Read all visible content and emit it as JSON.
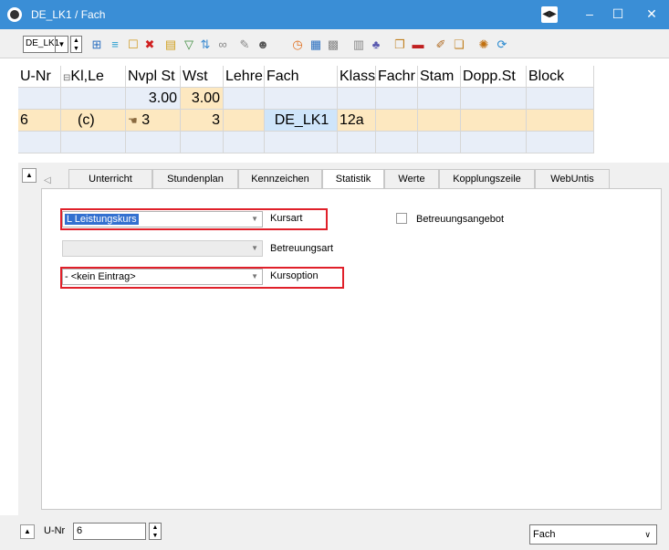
{
  "window": {
    "title": "DE_LK1 / Fach",
    "nav_label": "◀▶",
    "minimize": "–",
    "maximize": "☐",
    "close": "✕"
  },
  "toolbar": {
    "selector_value": "DE_LK1",
    "icons": [
      "new-record-icon",
      "list-icon",
      "edit-icon",
      "delete-icon",
      "filter-list-icon",
      "filter-icon",
      "sort-icon",
      "link-icon",
      "tools-icon",
      "user-icon",
      "clock-icon",
      "calendar-icon",
      "schedule-icon",
      "grid-icon",
      "people-icon",
      "copy-icon",
      "monitor-icon",
      "pencil-icon",
      "page-settings-icon",
      "gear-icon",
      "refresh-icon"
    ]
  },
  "grid": {
    "columns": [
      "U-Nr",
      "Kl,Le",
      "Nvpl St",
      "Wst",
      "Lehrer",
      "Fach",
      "Klass",
      "Fachr",
      "Stam",
      "Dopp.St",
      "Block"
    ],
    "rows": [
      [
        "",
        "",
        "3.00",
        "3.00",
        "",
        "",
        "",
        "",
        "",
        "",
        ""
      ],
      [
        "6",
        "(c)",
        "3",
        "3",
        "",
        "DE_LK1",
        "12a",
        "",
        "",
        "",
        ""
      ],
      [
        "",
        "",
        "",
        "",
        "",
        "",
        "",
        "",
        "",
        "",
        ""
      ]
    ]
  },
  "tabs": [
    {
      "label": "Unterricht"
    },
    {
      "label": "Stundenplan"
    },
    {
      "label": "Kennzeichen"
    },
    {
      "label": "Statistik"
    },
    {
      "label": "Werte"
    },
    {
      "label": "Kopplungszeile"
    },
    {
      "label": "WebUntis"
    }
  ],
  "form": {
    "kursart": {
      "value": "L  Leistungskurs",
      "label": "Kursart"
    },
    "betreuungsart": {
      "value": "",
      "label": "Betreuungsart"
    },
    "kursoption": {
      "value": "-  <kein Eintrag>",
      "label": "Kursoption"
    },
    "betreuungsangebot": {
      "label": "Betreuungsangebot",
      "checked": false
    }
  },
  "statusbar": {
    "field_label": "U-Nr",
    "field_value": "6",
    "select_value": "Fach"
  },
  "colors": {
    "titlebar": "#3a8ed6",
    "selected_row": "#fde8c0",
    "highlight_cell": "#cfe5fa",
    "annotation_red": "#e0202a"
  }
}
